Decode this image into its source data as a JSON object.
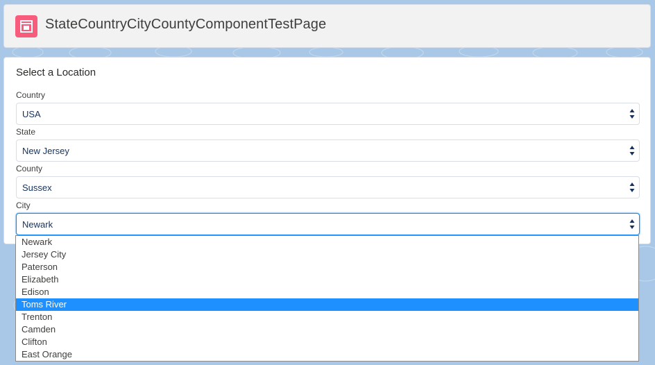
{
  "header": {
    "title": "StateCountryCityCountyComponentTestPage",
    "icon": "lightning-page-icon",
    "icon_color": "#f85c7d"
  },
  "card": {
    "title": "Select a Location",
    "fields": {
      "country": {
        "label": "Country",
        "value": "USA"
      },
      "state": {
        "label": "State",
        "value": "New Jersey"
      },
      "county": {
        "label": "County",
        "value": "Sussex"
      },
      "city": {
        "label": "City",
        "value": "Newark"
      }
    }
  },
  "city_dropdown": {
    "options": [
      "Newark",
      "Jersey City",
      "Paterson",
      "Elizabeth",
      "Edison",
      "Toms River",
      "Trenton",
      "Camden",
      "Clifton",
      "East Orange"
    ],
    "highlighted": "Toms River"
  },
  "colors": {
    "background": "#a9c7e6",
    "highlight": "#1e90ff",
    "focus_border": "#1589ee"
  }
}
